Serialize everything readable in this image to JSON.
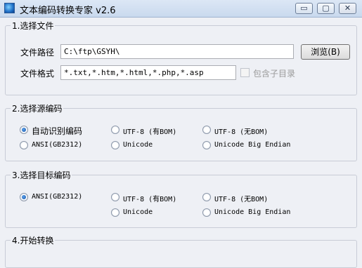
{
  "window": {
    "title": "文本编码转换专家 v2.6",
    "buttons": {
      "minimize": "▭",
      "maximize": "▢",
      "close": "✕"
    }
  },
  "section1": {
    "title": "1.选择文件",
    "path_label": "文件路径",
    "path_value": "C:\\ftp\\GSYH\\",
    "browse_label": "浏览(B)",
    "format_label": "文件格式",
    "format_value": "*.txt,*.htm,*.html,*.php,*.asp",
    "include_sub_label": "包含子目录"
  },
  "section2": {
    "title": "2.选择源编码",
    "options": [
      {
        "label": "自动识别编码",
        "checked": true
      },
      {
        "label": "UTF-8 (有BOM)",
        "checked": false
      },
      {
        "label": "UTF-8 (无BOM)",
        "checked": false
      },
      {
        "label": "ANSI(GB2312)",
        "checked": false
      },
      {
        "label": "Unicode",
        "checked": false
      },
      {
        "label": "Unicode Big Endian",
        "checked": false
      }
    ]
  },
  "section3": {
    "title": "3.选择目标编码",
    "options": [
      {
        "label": "ANSI(GB2312)",
        "checked": true
      },
      {
        "label": "UTF-8 (有BOM)",
        "checked": false
      },
      {
        "label": "UTF-8 (无BOM)",
        "checked": false
      },
      {
        "label": "Unicode",
        "checked": false
      },
      {
        "label": "Unicode Big Endian",
        "checked": false
      }
    ]
  },
  "section4": {
    "title": "4.开始转换"
  }
}
